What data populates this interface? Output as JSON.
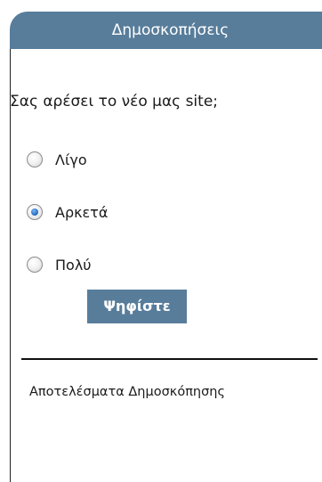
{
  "poll": {
    "title": "Δημοσκοπήσεις",
    "question": "Σας αρέσει το νέο μας site;",
    "options": [
      {
        "label": "Λίγο",
        "checked": false
      },
      {
        "label": "Αρκετά",
        "checked": true
      },
      {
        "label": "Πολύ",
        "checked": false
      }
    ],
    "vote_label": "Ψηφίστε",
    "results_label": "Αποτελέσματα Δημοσκόπησης"
  },
  "colors": {
    "header_bg": "#587d9b",
    "button_bg": "#587d9b",
    "selected_radio": "#2a6fc4"
  }
}
